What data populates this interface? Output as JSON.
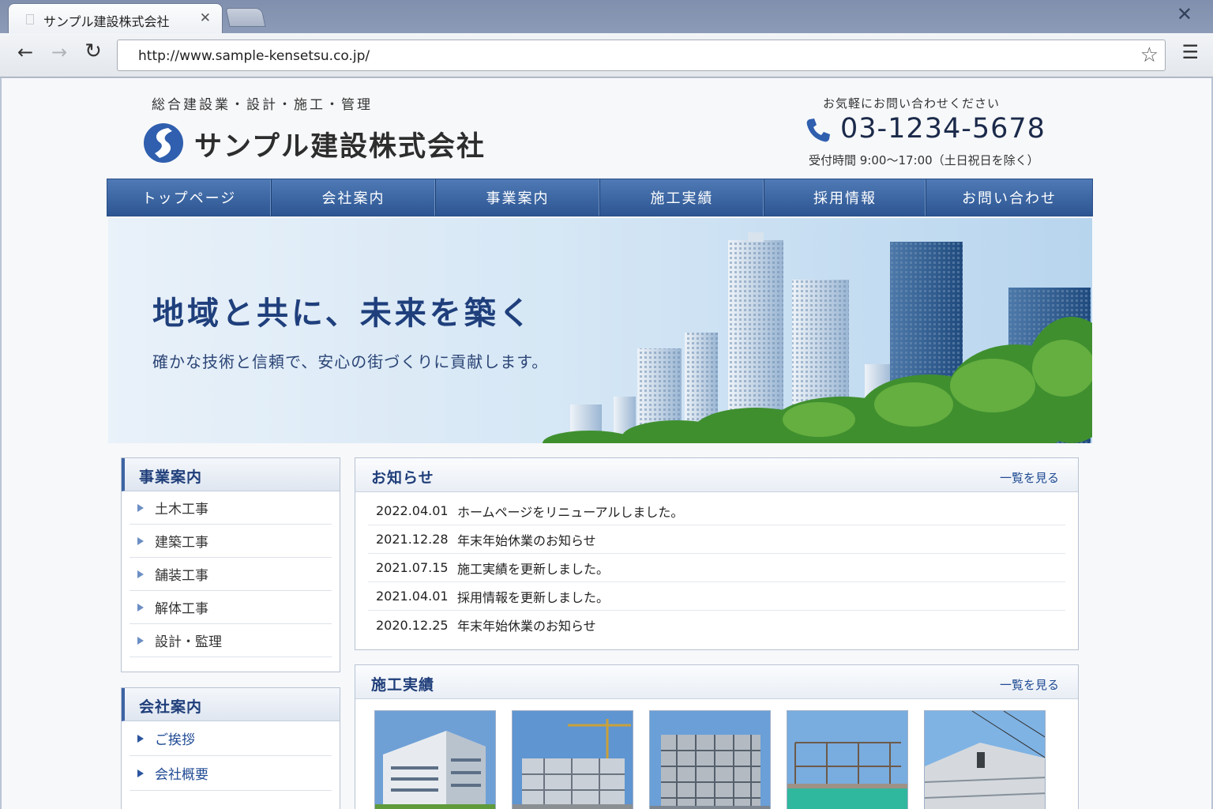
{
  "browser": {
    "tab_title": "サンプル建設株式会社",
    "tab_close": "✕",
    "window_close": "✕",
    "url": "http://www.sample-kensetsu.co.jp/",
    "icons": [
      "document-icon",
      "back-arrow-icon",
      "forward-arrow-icon",
      "reload-icon",
      "star-icon",
      "hamburger-menu-icon"
    ]
  },
  "header": {
    "tagline": "総合建設業・設計・施工・管理",
    "company_name": "サンプル建設株式会社",
    "contact_lead": "お気軽にお問い合わせください",
    "phone": "03-1234-5678",
    "hours": "受付時間 9:00〜17:00（土日祝日を除く）"
  },
  "gnav": {
    "items": [
      {
        "label": "トップページ"
      },
      {
        "label": "会社案内"
      },
      {
        "label": "事業案内"
      },
      {
        "label": "施工実績"
      },
      {
        "label": "採用情報"
      },
      {
        "label": "お問い合わせ"
      }
    ]
  },
  "hero": {
    "title": "地域と共に、未来を築く",
    "subtitle": "確かな技術と信頼で、安心の街づくりに貢献します。"
  },
  "sidebar": {
    "business": {
      "title": "事業案内",
      "items": [
        {
          "label": "土木工事"
        },
        {
          "label": "建築工事"
        },
        {
          "label": "舗装工事"
        },
        {
          "label": "解体工事"
        },
        {
          "label": "設計・監理"
        }
      ]
    },
    "company": {
      "title": "会社案内",
      "items": [
        {
          "label": "ご挨拶"
        },
        {
          "label": "会社概要"
        }
      ]
    }
  },
  "news": {
    "title": "お知らせ",
    "more": "一覧を見る",
    "items": [
      {
        "date": "2022.04.01",
        "text": "ホームページをリニューアルしました。"
      },
      {
        "date": "2021.12.28",
        "text": "年末年始休業のお知らせ"
      },
      {
        "date": "2021.07.15",
        "text": "施工実績を更新しました。"
      },
      {
        "date": "2021.04.01",
        "text": "採用情報を更新しました。"
      },
      {
        "date": "2020.12.25",
        "text": "年末年始休業のお知らせ"
      }
    ]
  },
  "works": {
    "title": "施工実績",
    "more": "一覧を見る"
  },
  "colors": {
    "nav_blue": "#3a64a3",
    "heading_navy": "#1f3e7a",
    "link_blue": "#1f4a93",
    "logo_blue": "#2f5fae"
  }
}
